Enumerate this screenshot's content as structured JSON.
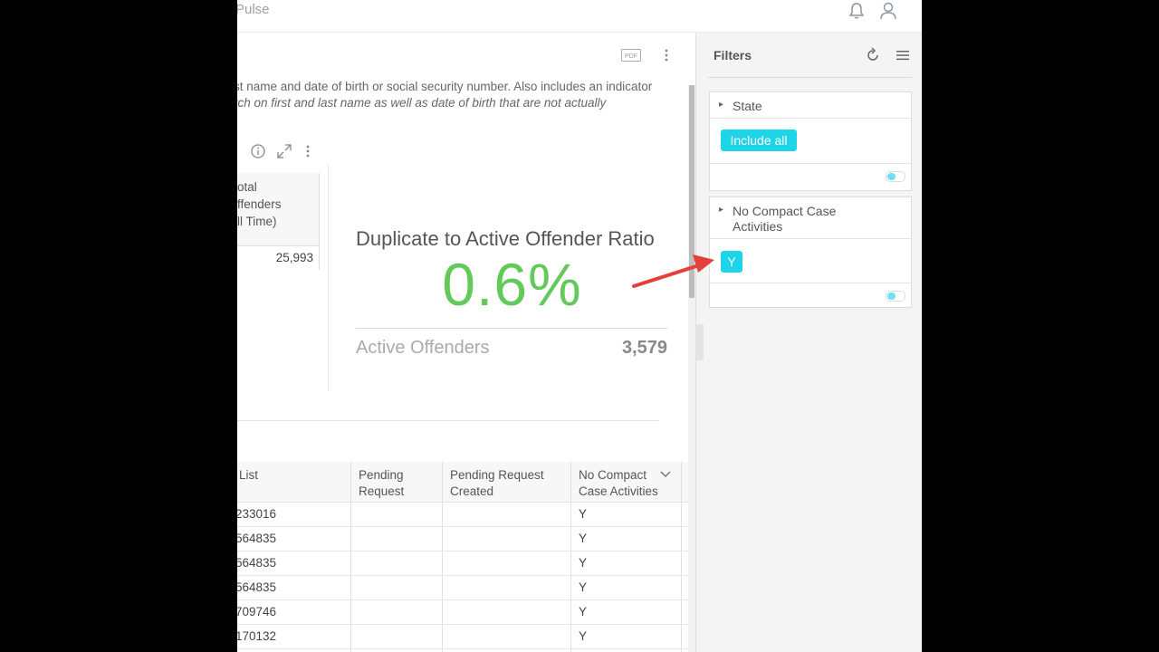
{
  "topbar": {
    "brand": "Pulse",
    "notification_icon": "bell-icon",
    "user_icon": "user-icon"
  },
  "main": {
    "pdf_label": "PDF",
    "description_line1": "st name and date of birth or social security number. Also includes an indicator",
    "description_line2": "rch on first and last name as well as date of birth that are not actually",
    "small_table": {
      "header": "otal\nffenders\nll Time)",
      "value": "25,993"
    },
    "kpi": {
      "title": "Duplicate to Active Offender Ratio",
      "value": "0.6%",
      "sub_label": "Active Offenders",
      "sub_value": "3,579",
      "value_color": "#62c95a"
    },
    "table": {
      "columns": [
        "List",
        "Pending\nRequest",
        "Pending Request\nCreated",
        "No Compact\nCase Activities"
      ],
      "rows": [
        [
          "233016",
          "",
          "",
          "Y"
        ],
        [
          "564835",
          "",
          "",
          "Y"
        ],
        [
          "564835",
          "",
          "",
          "Y"
        ],
        [
          "564835",
          "",
          "",
          "Y"
        ],
        [
          "709746",
          "",
          "",
          "Y"
        ],
        [
          "170132",
          "",
          "",
          "Y"
        ]
      ]
    }
  },
  "filters": {
    "title": "Filters",
    "cards": [
      {
        "title": "State",
        "chip": "Include all"
      },
      {
        "title": "No Compact Case\nActivities",
        "chip": "Y"
      }
    ],
    "accent_color": "#1ed4e8"
  }
}
